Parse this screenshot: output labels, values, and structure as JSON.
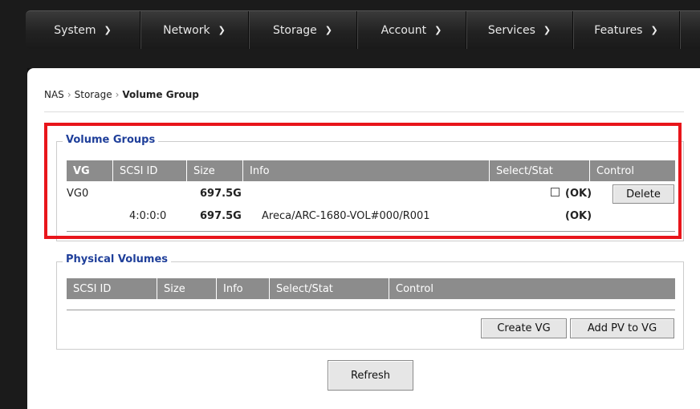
{
  "nav": [
    {
      "label": "System"
    },
    {
      "label": "Network"
    },
    {
      "label": "Storage"
    },
    {
      "label": "Account"
    },
    {
      "label": "Services"
    },
    {
      "label": "Features"
    }
  ],
  "breadcrumb": {
    "root": "NAS",
    "section": "Storage",
    "current": "Volume Group",
    "sep": "›"
  },
  "volume_groups": {
    "title": "Volume Groups",
    "columns": [
      "VG",
      "SCSI ID",
      "Size",
      "Info",
      "Select/Stat",
      "Control"
    ],
    "rows": [
      {
        "vg": "VG0",
        "scsi_id": "",
        "size": "697.5G",
        "info": "",
        "status": "(OK)",
        "control": "Delete"
      },
      {
        "vg": "",
        "scsi_id": "4:0:0:0",
        "size": "697.5G",
        "info": "Areca/ARC-1680-VOL#000/R001",
        "status": "(OK)",
        "control": ""
      }
    ]
  },
  "physical_volumes": {
    "title": "Physical Volumes",
    "columns": [
      "SCSI ID",
      "Size",
      "Info",
      "Select/Stat",
      "Control"
    ],
    "buttons": {
      "create": "Create VG",
      "add": "Add PV to VG"
    }
  },
  "refresh_label": "Refresh",
  "colors": {
    "highlight": "#e8151b",
    "legend": "#1f3f9a",
    "header": "#8c8c8c"
  }
}
